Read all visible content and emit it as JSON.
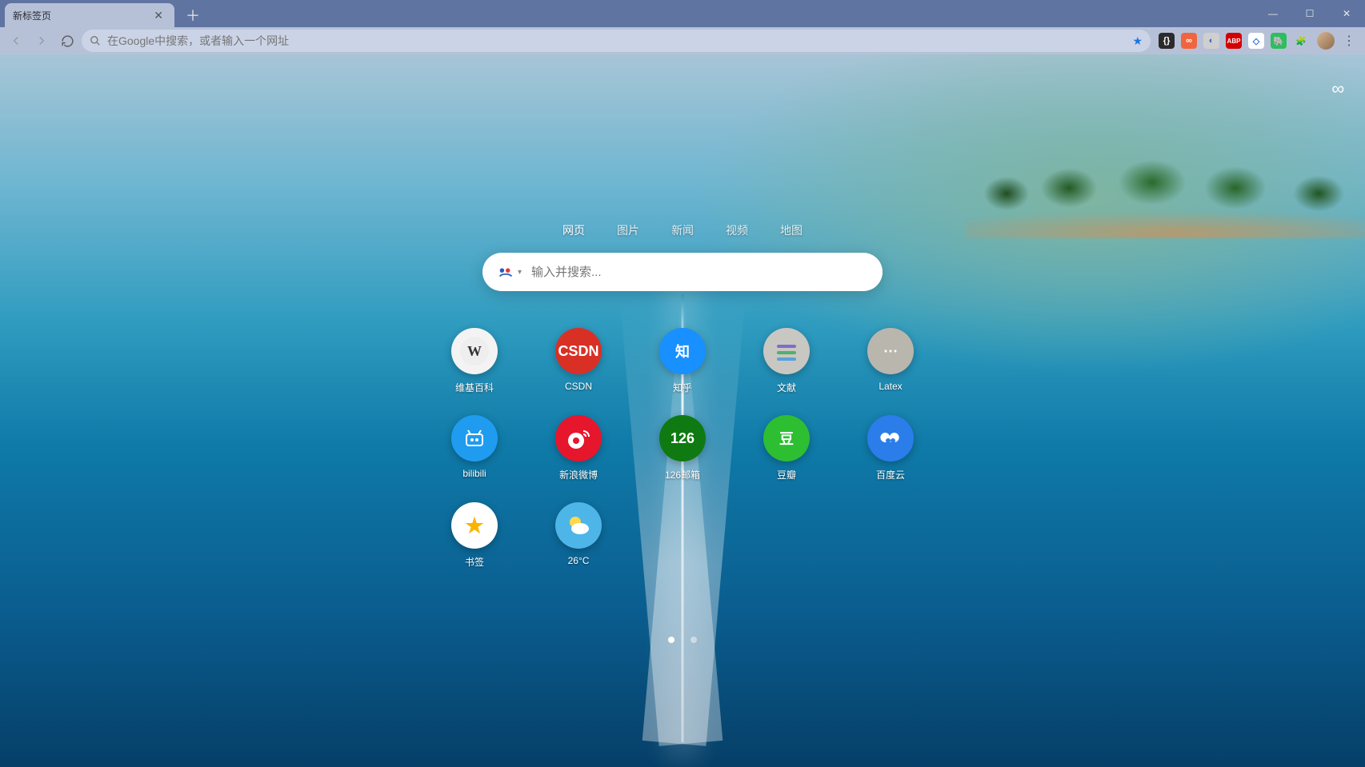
{
  "browser_tab": {
    "title": "新标签页"
  },
  "omnibox": {
    "placeholder": "在Google中搜索，或者输入一个网址"
  },
  "extensions": [
    {
      "name": "ext-code",
      "bg": "#2b2b2b",
      "glyph": "{}"
    },
    {
      "name": "ext-infinity",
      "bg": "#f0653f",
      "glyph": "∞"
    },
    {
      "name": "ext-moon",
      "bg": "#cfcfcf",
      "glyph": "◐"
    },
    {
      "name": "ext-abp",
      "bg": "#d40000",
      "glyph": "ABP"
    },
    {
      "name": "ext-diamond",
      "bg": "#ffffff",
      "glyph": "◇"
    },
    {
      "name": "ext-evernote",
      "bg": "#2dbe60",
      "glyph": "🐘"
    },
    {
      "name": "ext-puzzle",
      "bg": "transparent",
      "glyph": "🧩"
    }
  ],
  "search_tabs": [
    {
      "label": "网页",
      "active": true
    },
    {
      "label": "图片",
      "active": false
    },
    {
      "label": "新闻",
      "active": false
    },
    {
      "label": "视频",
      "active": false
    },
    {
      "label": "地图",
      "active": false
    }
  ],
  "searchbox": {
    "placeholder": "输入并搜索..."
  },
  "tiles": [
    {
      "id": "wikipedia",
      "label": "维基百科",
      "class": "c-wiki",
      "glyph": "W"
    },
    {
      "id": "csdn",
      "label": "CSDN",
      "class": "c-csdn",
      "glyph": "CSDN"
    },
    {
      "id": "zhihu",
      "label": "知乎",
      "class": "c-zhihu",
      "glyph": "知"
    },
    {
      "id": "wenxian",
      "label": "文献",
      "class": "c-doc",
      "glyph": "≡"
    },
    {
      "id": "latex",
      "label": "Latex",
      "class": "c-latex",
      "glyph": "⋯"
    },
    {
      "id": "bilibili",
      "label": "bilibili",
      "class": "c-bili",
      "glyph": "▶"
    },
    {
      "id": "weibo",
      "label": "新浪微博",
      "class": "c-weibo",
      "glyph": "◉"
    },
    {
      "id": "126mail",
      "label": "126邮箱",
      "class": "c-126",
      "glyph": "126"
    },
    {
      "id": "douban",
      "label": "豆瓣",
      "class": "c-douban",
      "glyph": "豆"
    },
    {
      "id": "baiduyun",
      "label": "百度云",
      "class": "c-baidu",
      "glyph": "☁"
    },
    {
      "id": "bookmarks",
      "label": "书签",
      "class": "c-bookmark",
      "glyph": "★"
    },
    {
      "id": "weather",
      "label": "26°C",
      "class": "c-weather",
      "glyph": "⛅"
    }
  ],
  "pager": {
    "count": 2,
    "active": 0
  }
}
